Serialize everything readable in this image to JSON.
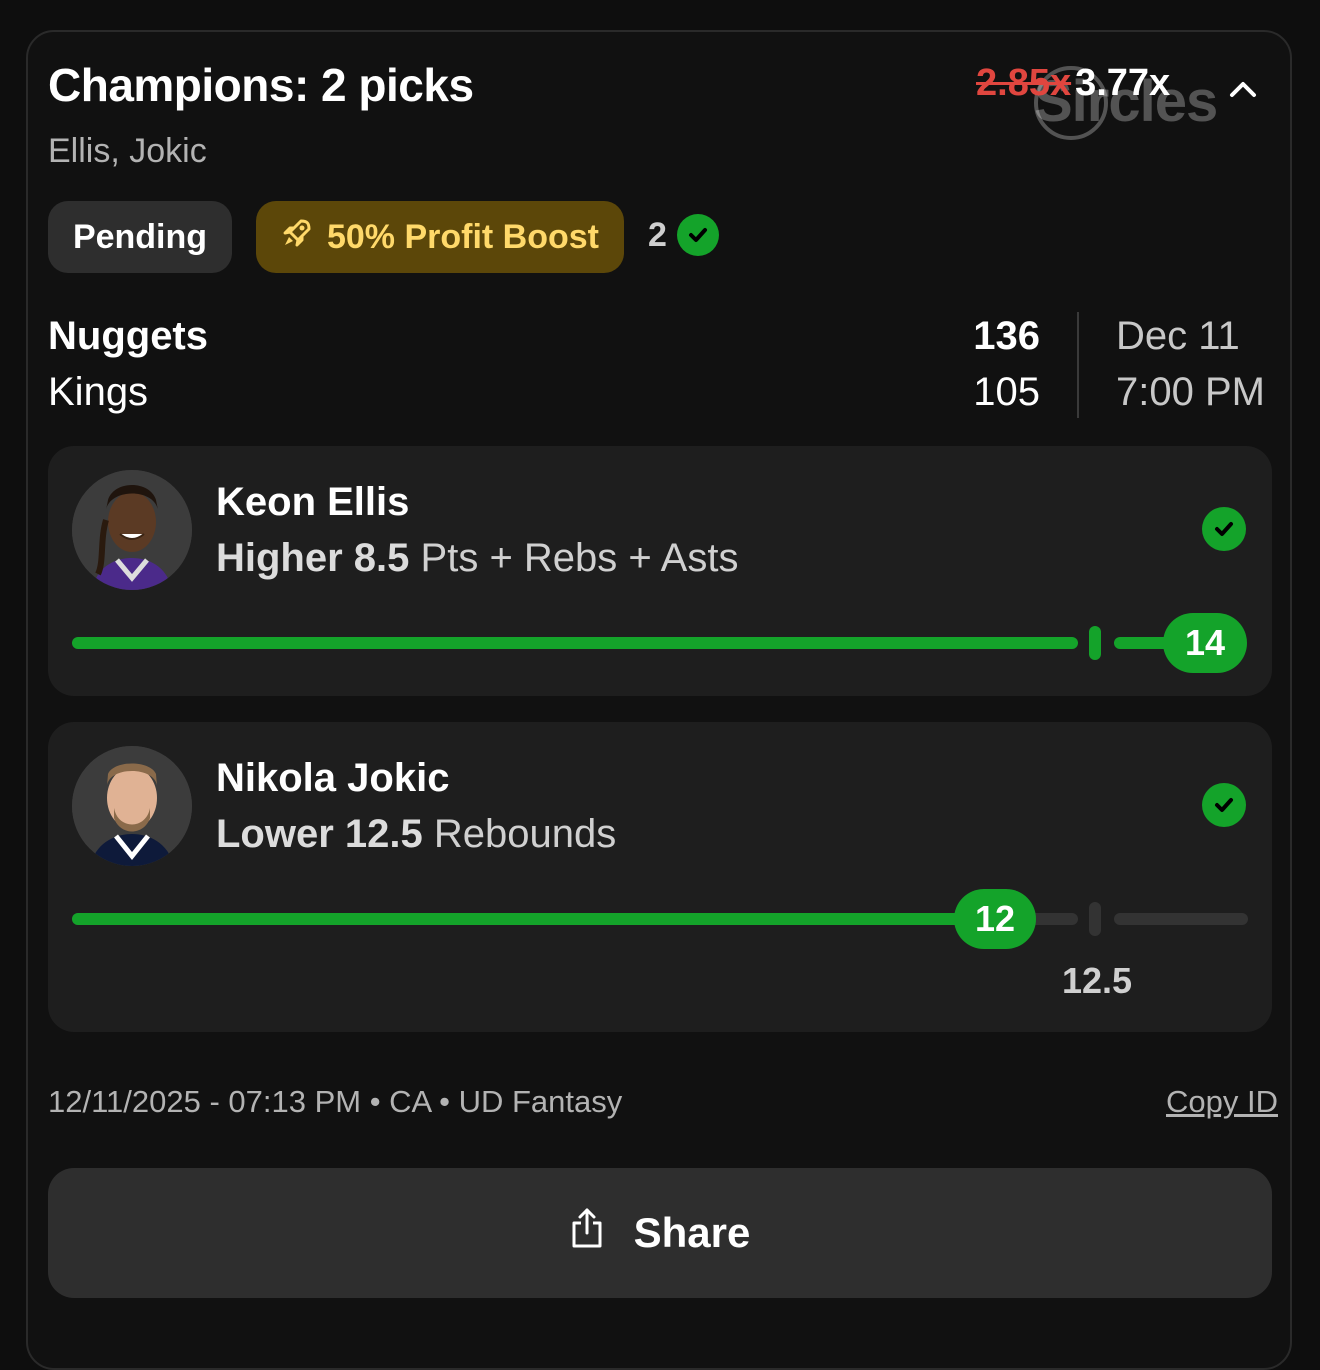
{
  "header": {
    "title": "Champions: 2 picks",
    "subtitle": "Ellis, Jokic",
    "old_multiplier": "2.85x",
    "new_multiplier": "3.77x",
    "watermark": "Sircles"
  },
  "badges": {
    "status": "Pending",
    "boost": "50% Profit Boost",
    "wins_count": "2",
    "boost_color": "#5c4709",
    "success_color": "#14a32a"
  },
  "game": {
    "team_home": "Nuggets",
    "team_away": "Kings",
    "score_home": "136",
    "score_away": "105",
    "date": "Dec 11",
    "time": "7:00 PM"
  },
  "picks": [
    {
      "player": "Keon Ellis",
      "direction_line": "Higher 8.5",
      "stat": "Pts + Rebs + Asts",
      "result": "14",
      "line": 8.5,
      "progress_fraction": 1.0
    },
    {
      "player": "Nikola Jokic",
      "direction_line": "Lower 12.5",
      "stat": "Rebounds",
      "result": "12",
      "line_label": "12.5",
      "line": 12.5,
      "progress_fraction": 0.96
    }
  ],
  "footer": {
    "meta": "12/11/2025 - 07:13 PM • CA • UD Fantasy",
    "copy_id": "Copy ID",
    "share": "Share"
  }
}
